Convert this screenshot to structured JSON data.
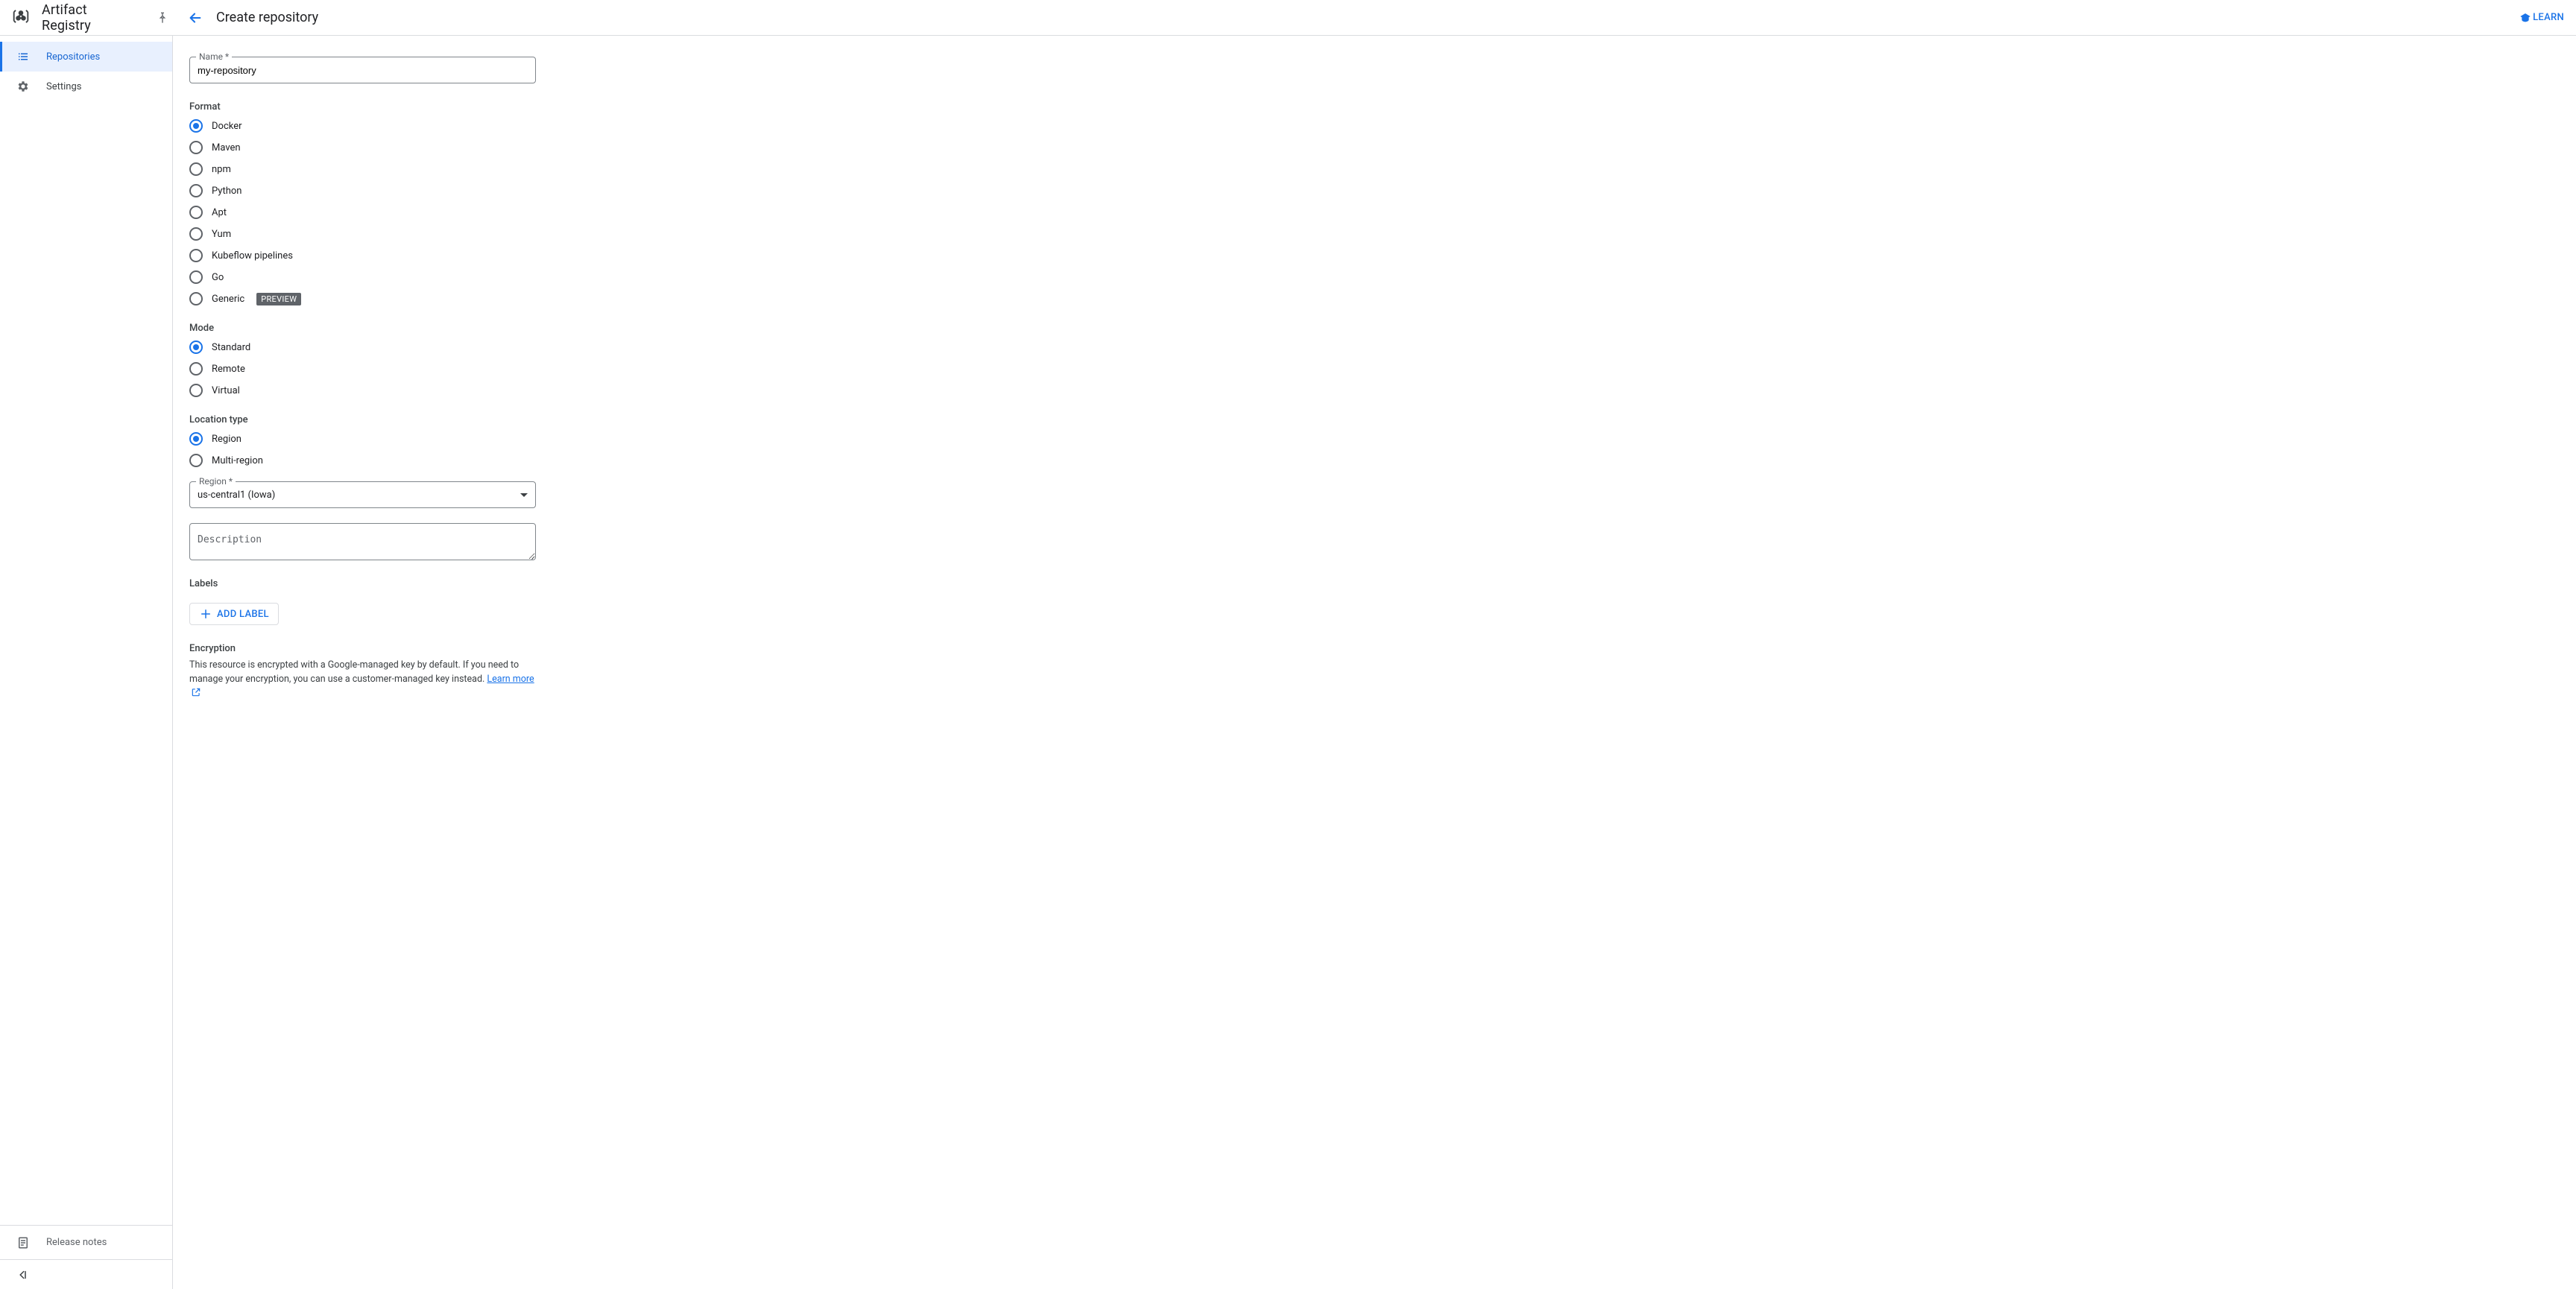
{
  "header": {
    "product_name": "Artifact Registry",
    "page_title": "Create repository",
    "learn_label": "LEARN"
  },
  "sidebar": {
    "items": [
      {
        "id": "repositories",
        "label": "Repositories",
        "active": true
      },
      {
        "id": "settings",
        "label": "Settings",
        "active": false
      }
    ],
    "release_notes_label": "Release notes"
  },
  "form": {
    "name_label": "Name *",
    "name_value": "my-repository",
    "format_label": "Format",
    "format_options": [
      {
        "id": "docker",
        "label": "Docker",
        "checked": true
      },
      {
        "id": "maven",
        "label": "Maven"
      },
      {
        "id": "npm",
        "label": "npm"
      },
      {
        "id": "python",
        "label": "Python"
      },
      {
        "id": "apt",
        "label": "Apt"
      },
      {
        "id": "yum",
        "label": "Yum"
      },
      {
        "id": "kubeflow",
        "label": "Kubeflow pipelines"
      },
      {
        "id": "go",
        "label": "Go"
      },
      {
        "id": "generic",
        "label": "Generic",
        "badge": "PREVIEW"
      }
    ],
    "mode_label": "Mode",
    "mode_options": [
      {
        "id": "standard",
        "label": "Standard",
        "checked": true
      },
      {
        "id": "remote",
        "label": "Remote"
      },
      {
        "id": "virtual",
        "label": "Virtual"
      }
    ],
    "location_type_label": "Location type",
    "location_type_options": [
      {
        "id": "region",
        "label": "Region",
        "checked": true
      },
      {
        "id": "multi",
        "label": "Multi-region"
      }
    ],
    "region_label": "Region *",
    "region_value": "us-central1 (Iowa)",
    "description_placeholder": "Description",
    "labels_label": "Labels",
    "add_label_button": "ADD LABEL",
    "encryption_label": "Encryption",
    "encryption_body": "This resource is encrypted with a Google-managed key by default. If you need to manage your encryption, you can use a customer-managed key instead.",
    "learn_more_label": "Learn more"
  }
}
